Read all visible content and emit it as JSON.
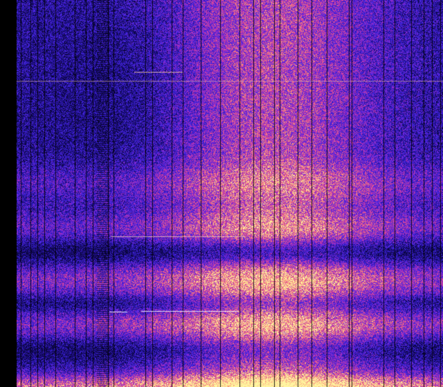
{
  "view": {
    "colormap": "plasma",
    "colors": {
      "background": "#000000",
      "low": "#1a0a5c",
      "mid_low": "#3a1fd0",
      "mid": "#9b2fc8",
      "mid_high": "#e8508a",
      "high": "#ffd38a",
      "peak": "#fff7a8"
    },
    "content": "spectrogram-heatmap"
  }
}
